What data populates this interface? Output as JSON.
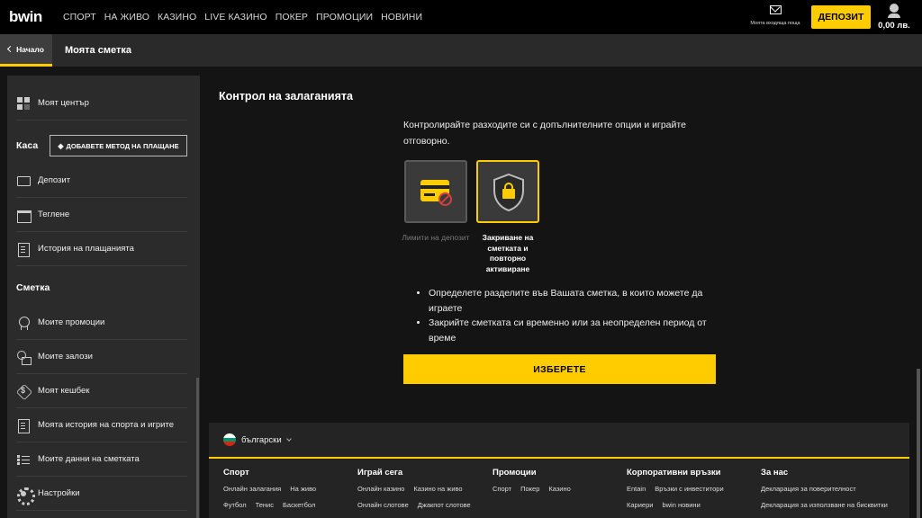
{
  "topbar": {
    "logo": "bwin",
    "nav": [
      "СПОРТ",
      "НА ЖИВО",
      "КАЗИНО",
      "LIVE КАЗИНО",
      "ПОКЕР",
      "ПРОМОЦИИ",
      "НОВИНИ"
    ],
    "inbox_label": "Моята входяща поща",
    "deposit_label": "ДЕПОЗИТ",
    "balance": "0,00 лв."
  },
  "breadcrumb": {
    "back_label": "Начало",
    "title": "Моята сметка"
  },
  "sidebar": {
    "my_center": "Моят център",
    "cashier_heading": "Каса",
    "add_payment": "ДОБАВЕТЕ МЕТОД НА ПЛАЩАНЕ",
    "cashier_items": [
      "Депозит",
      "Теглене",
      "История на плащанията"
    ],
    "account_heading": "Сметка",
    "account_items": [
      "Моите промоции",
      "Моите залози",
      "Моят кешбек",
      "Моята история на спорта и игрите",
      "Моите данни на сметката",
      "Настройки"
    ]
  },
  "main": {
    "title": "Контрол на залаганията",
    "intro": "Контролирайте разходите си с допълнителните опции и играйте отговорно.",
    "options": [
      {
        "label": "Лимити на депозит",
        "icon": "credit-card-icon"
      },
      {
        "label": "Закриване на сметката и повторно активиране",
        "icon": "shield-lock-icon"
      }
    ],
    "bullets": [
      "Определете разделите във Вашата сметка, в които можете да играете",
      "Закрийте сметката си временно или за неопределен период от време"
    ],
    "choose_label": "ИЗБЕРЕТЕ"
  },
  "footer": {
    "language": "български",
    "columns": [
      {
        "heading": "Спорт",
        "rows": [
          [
            "Онлайн залагания",
            "На живо"
          ],
          [
            "Футбол",
            "Тенис",
            "Баскетбол"
          ]
        ]
      },
      {
        "heading": "Играй сега",
        "rows": [
          [
            "Онлайн казино",
            "Казино на живо"
          ],
          [
            "Онлайн слотове",
            "Джакпот слотове"
          ]
        ]
      },
      {
        "heading": "Промоции",
        "rows": [
          [
            "Спорт",
            "Покер",
            "Казино"
          ]
        ]
      },
      {
        "heading": "Корпоративни връзки",
        "rows": [
          [
            "Entain",
            "Връзки с инвеститори"
          ],
          [
            "Кариери",
            "bwin новини"
          ]
        ]
      },
      {
        "heading": "За нас",
        "rows": [
          [
            "Декларация за поверителност"
          ],
          [
            "Декларация за използване на бисквитки"
          ]
        ]
      }
    ]
  },
  "colors": {
    "accent": "#ffcc00",
    "background": "#141414",
    "panel": "#2b2b2b"
  }
}
